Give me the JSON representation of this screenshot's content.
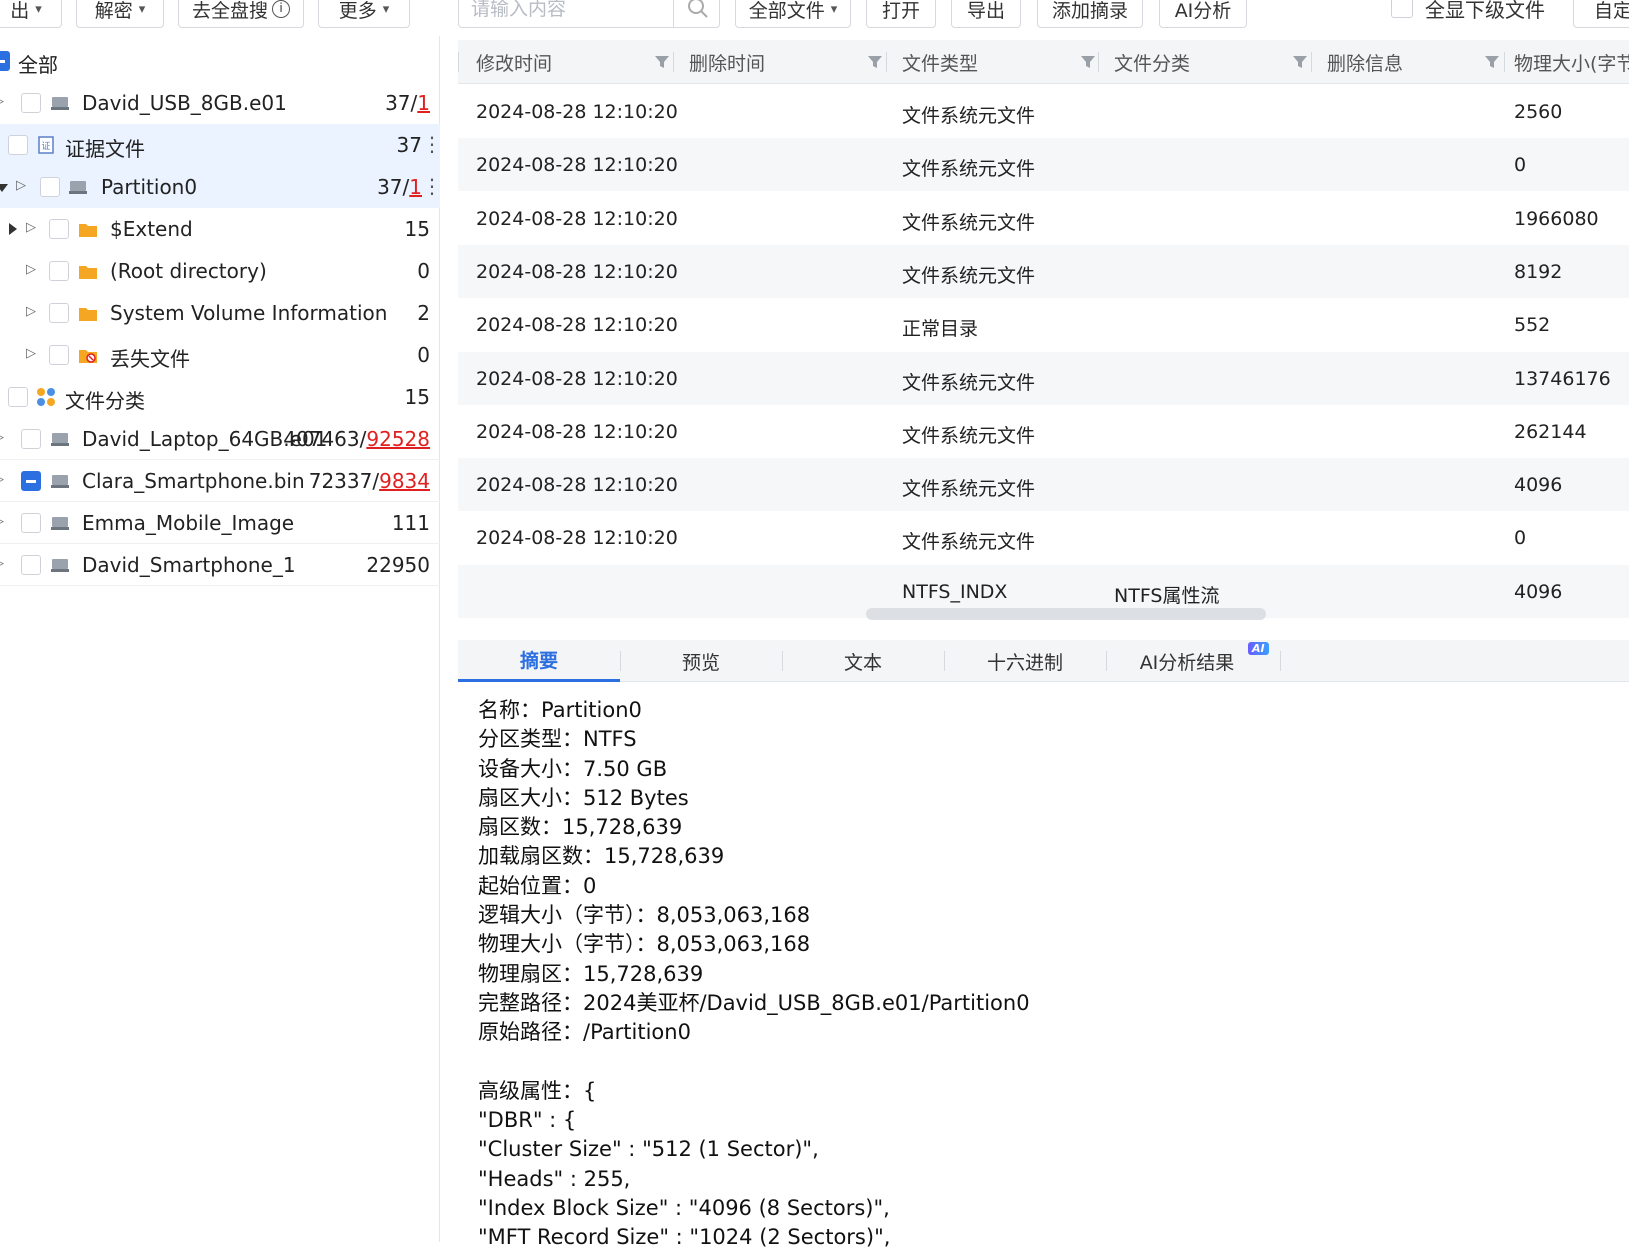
{
  "toolbar_left": {
    "export_label": "出",
    "decrypt_label": "解密",
    "go_search_label": "去全盘搜",
    "more_label": "更多"
  },
  "toolbar_right": {
    "search_placeholder": "请输入内容",
    "file_filter_label": "全部文件",
    "open_label": "打开",
    "export_label": "导出",
    "add_bookmark_label": "添加摘录",
    "ai_analyze_label": "AI分析",
    "show_sub_files_label": "全显下级文件",
    "custom_label": "自定"
  },
  "tree": {
    "root_label": "全部",
    "items": [
      {
        "label": "David_USB_8GB.e01",
        "count": "37/",
        "count_red": "1"
      },
      {
        "label": "证据文件",
        "count": "37",
        "count_red": ""
      },
      {
        "label": "Partition0",
        "count": "37/",
        "count_red": "1"
      },
      {
        "label": "$Extend",
        "count": "15",
        "count_red": ""
      },
      {
        "label": "(Root directory)",
        "count": "0",
        "count_red": ""
      },
      {
        "label": "System Volume Information",
        "count": "2",
        "count_red": ""
      },
      {
        "label": "丢失文件",
        "count": "0",
        "count_red": ""
      },
      {
        "label": "文件分类",
        "count": "15",
        "count_red": ""
      },
      {
        "label": "David_Laptop_64GB.e01",
        "count": "407463/",
        "count_red": "92528"
      },
      {
        "label": "Clara_Smartphone.bin",
        "count": "72337/",
        "count_red": "9834"
      },
      {
        "label": "Emma_Mobile_Image",
        "count": "111",
        "count_red": ""
      },
      {
        "label": "David_Smartphone_1",
        "count": "22950",
        "count_red": ""
      }
    ]
  },
  "table": {
    "columns": [
      "修改时间",
      "删除时间",
      "文件类型",
      "文件分类",
      "删除信息",
      "物理大小(字节"
    ],
    "rows": [
      {
        "modified": "2024-08-28 12:10:20",
        "deleted": "",
        "type": "文件系统元文件",
        "category": "",
        "del_info": "",
        "size": "2560"
      },
      {
        "modified": "2024-08-28 12:10:20",
        "deleted": "",
        "type": "文件系统元文件",
        "category": "",
        "del_info": "",
        "size": "0"
      },
      {
        "modified": "2024-08-28 12:10:20",
        "deleted": "",
        "type": "文件系统元文件",
        "category": "",
        "del_info": "",
        "size": "1966080"
      },
      {
        "modified": "2024-08-28 12:10:20",
        "deleted": "",
        "type": "文件系统元文件",
        "category": "",
        "del_info": "",
        "size": "8192"
      },
      {
        "modified": "2024-08-28 12:10:20",
        "deleted": "",
        "type": "正常目录",
        "category": "",
        "del_info": "",
        "size": "552"
      },
      {
        "modified": "2024-08-28 12:10:20",
        "deleted": "",
        "type": "文件系统元文件",
        "category": "",
        "del_info": "",
        "size": "13746176"
      },
      {
        "modified": "2024-08-28 12:10:20",
        "deleted": "",
        "type": "文件系统元文件",
        "category": "",
        "del_info": "",
        "size": "262144"
      },
      {
        "modified": "2024-08-28 12:10:20",
        "deleted": "",
        "type": "文件系统元文件",
        "category": "",
        "del_info": "",
        "size": "4096"
      },
      {
        "modified": "2024-08-28 12:10:20",
        "deleted": "",
        "type": "文件系统元文件",
        "category": "",
        "del_info": "",
        "size": "0"
      },
      {
        "modified": "",
        "deleted": "",
        "type": "NTFS_INDX",
        "category": "NTFS属性流",
        "del_info": "",
        "size": "4096"
      }
    ]
  },
  "tabs": {
    "items": [
      "摘要",
      "预览",
      "文本",
      "十六进制",
      "AI分析结果"
    ],
    "active": "摘要",
    "ai_badge": "AI"
  },
  "detail": {
    "lines": [
      "名称：Partition0",
      "分区类型：NTFS",
      "设备大小：7.50 GB",
      "扇区大小：512 Bytes",
      "扇区数：15,728,639",
      "加载扇区数：15,728,639",
      "起始位置：0",
      "逻辑大小（字节）：8,053,063,168",
      "物理大小（字节）：8,053,063,168",
      "物理扇区：15,728,639",
      "完整路径：2024美亚杯/David_USB_8GB.e01/Partition0",
      "原始路径：/Partition0",
      "",
      "高级属性：{",
      "\"DBR\" : {",
      "\"Cluster Size\" : \"512 (1 Sector)\",",
      "\"Heads\" : 255,",
      "\"Index Block Size\" : \"4096 (8 Sectors)\",",
      "\"MFT Record Size\" : \"1024 (2 Sectors)\","
    ]
  },
  "colors": {
    "accent": "#2b6fe0",
    "red_count": "#e02020",
    "selected_row": "#eaf3ff",
    "header_bg": "#f4f5f7",
    "folder": "#f5a623"
  }
}
